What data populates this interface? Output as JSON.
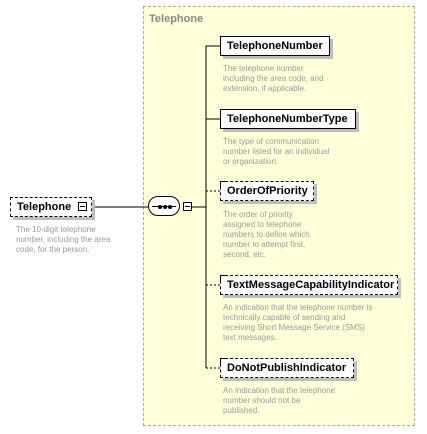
{
  "group": {
    "title": "Telephone"
  },
  "root": {
    "name": "Telephone",
    "description": [
      "The 10-digit telephone",
      "number, including the area",
      "code, for the person."
    ]
  },
  "children": [
    {
      "name": "TelephoneNumber",
      "optional": false,
      "description": [
        "The telephone number",
        "including the area code, and",
        "extension, if applicable."
      ]
    },
    {
      "name": "TelephoneNumberType",
      "optional": false,
      "description": [
        "The type of communication",
        "number listed for an individual",
        "or organization."
      ]
    },
    {
      "name": "OrderOfPriority",
      "optional": true,
      "description": [
        "The order of priority",
        "assigned to telephone",
        "numbers to define which",
        "number to attempt first,",
        "second, etc."
      ]
    },
    {
      "name": "TextMessageCapabilityIndicator",
      "optional": true,
      "description": [
        "An indication that the telephone number is",
        "technically capable of sending and",
        "receiving Short Message Service (SMS)",
        "text messages."
      ]
    },
    {
      "name": "DoNotPublishIndicator",
      "optional": true,
      "description": [
        "An indication that the telephone",
        "number should not be",
        "published."
      ]
    }
  ]
}
